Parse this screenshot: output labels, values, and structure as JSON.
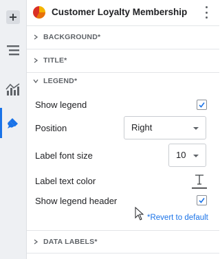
{
  "rail": {
    "items": [
      {
        "name": "add",
        "icon": "plus-icon"
      },
      {
        "name": "data",
        "icon": "bars-icon"
      },
      {
        "name": "chart",
        "icon": "chart-icon"
      },
      {
        "name": "format",
        "icon": "paint-icon",
        "active": true
      }
    ]
  },
  "header": {
    "title": "Customer Loyalty Membership",
    "icon": "pie-chart-icon",
    "menu_icon": "kebab-menu-icon"
  },
  "sections": {
    "background": "BACKGROUND*",
    "title": "TITLE*",
    "legend": "LEGEND*",
    "data_labels": "DATA LABELS*"
  },
  "legend": {
    "show_legend": {
      "label": "Show legend",
      "checked": true
    },
    "position": {
      "label": "Position",
      "value": "Right"
    },
    "label_font_size": {
      "label": "Label font size",
      "value": "10"
    },
    "label_text_color": {
      "label": "Label text color"
    },
    "show_legend_header": {
      "label": "Show legend header",
      "checked": true
    },
    "revert_link": "*Revert to default"
  },
  "colors": {
    "accent": "#1a73e8",
    "rail_bg": "#eef0f3",
    "section_text": "#5f6368"
  }
}
